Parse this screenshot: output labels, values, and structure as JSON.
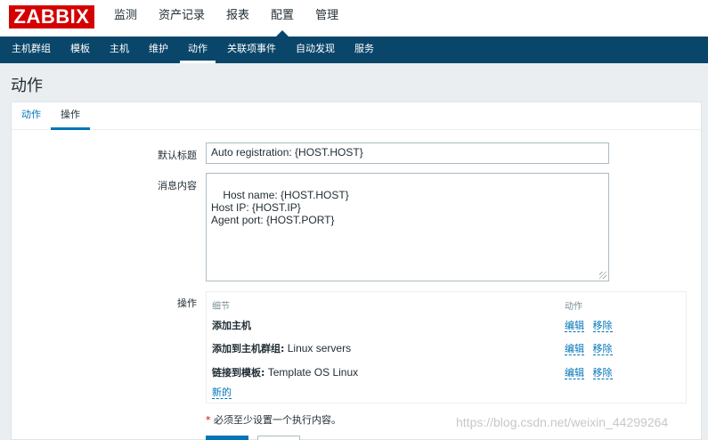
{
  "brand": {
    "logo": "ZABBIX",
    "logo_color": "#d40000"
  },
  "main_nav": [
    "监测",
    "资产记录",
    "报表",
    "配置",
    "管理"
  ],
  "main_nav_active": "配置",
  "sub_nav": [
    "主机群组",
    "模板",
    "主机",
    "维护",
    "动作",
    "关联项事件",
    "自动发现",
    "服务"
  ],
  "sub_nav_active": "动作",
  "page": {
    "title": "动作"
  },
  "tabs": [
    "动作",
    "操作"
  ],
  "tabs_active": "操作",
  "form": {
    "subject_label": "默认标题",
    "subject_value": "Auto registration: {HOST.HOST}",
    "message_label": "消息内容",
    "message_value": "Host name: {HOST.HOST}\nHost IP: {HOST.IP}\nAgent port: {HOST.PORT}",
    "operations_label": "操作"
  },
  "operations": {
    "col_details": "细节",
    "col_action": "动作",
    "rows": [
      {
        "bold": "添加主机",
        "value": "",
        "edit": "编辑",
        "remove": "移除"
      },
      {
        "bold": "添加到主机群组:",
        "value": " Linux servers",
        "edit": "编辑",
        "remove": "移除"
      },
      {
        "bold": "链接到模板:",
        "value": " Template OS Linux",
        "edit": "编辑",
        "remove": "移除"
      }
    ],
    "new_link": "新的"
  },
  "required_note": {
    "star": "*",
    "text": " 必须至少设置一个执行内容。"
  },
  "watermark": "https://blog.csdn.net/weixin_44299264",
  "colors": {
    "nav_bg": "#0a466a",
    "link": "#0275b8",
    "page_bg": "#ebeef0"
  }
}
